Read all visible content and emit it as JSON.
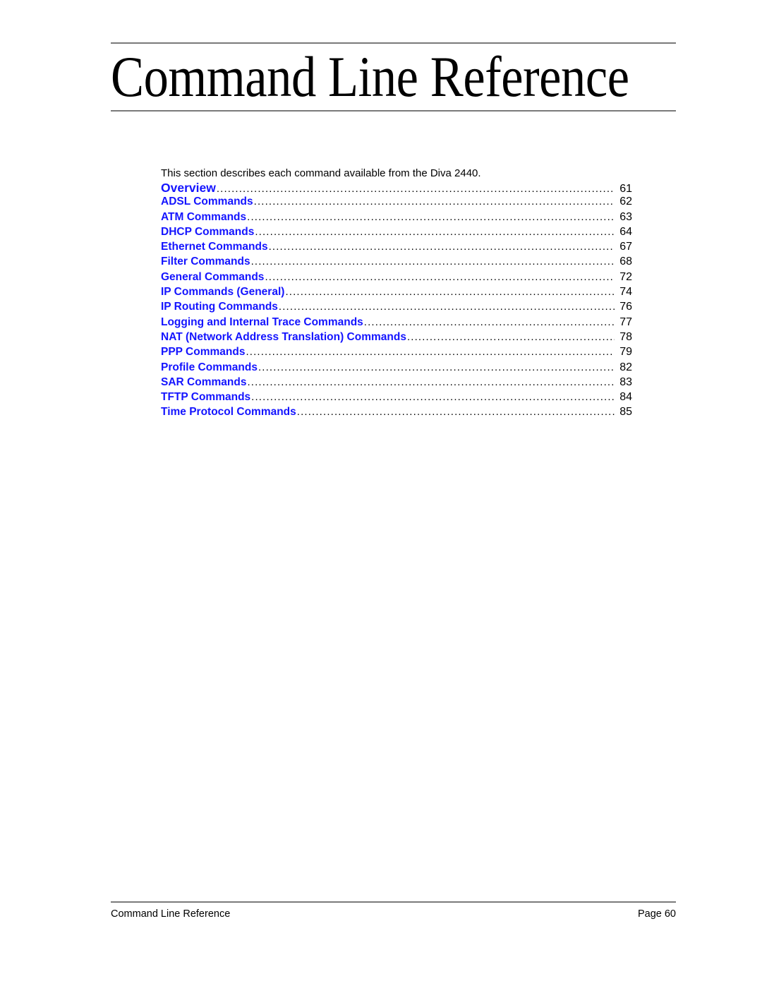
{
  "document": {
    "title": "Command Line Reference",
    "intro": "This section describes each command available from the Diva 2440."
  },
  "toc": {
    "entries": [
      {
        "label": "Overview",
        "page": "61",
        "lead": true
      },
      {
        "label": "ADSL Commands",
        "page": "62",
        "lead": false
      },
      {
        "label": "ATM Commands",
        "page": "63",
        "lead": false
      },
      {
        "label": "DHCP Commands",
        "page": "64",
        "lead": false
      },
      {
        "label": "Ethernet Commands",
        "page": "67",
        "lead": false
      },
      {
        "label": "Filter Commands",
        "page": "68",
        "lead": false
      },
      {
        "label": "General Commands",
        "page": "72",
        "lead": false
      },
      {
        "label": "IP Commands (General)",
        "page": "74",
        "lead": false
      },
      {
        "label": "IP Routing Commands",
        "page": "76",
        "lead": false
      },
      {
        "label": "Logging and Internal Trace Commands",
        "page": "77",
        "lead": false
      },
      {
        "label": "NAT (Network Address Translation) Commands",
        "page": "78",
        "lead": false
      },
      {
        "label": "PPP Commands",
        "page": "79",
        "lead": false
      },
      {
        "label": "Profile Commands",
        "page": "82",
        "lead": false
      },
      {
        "label": "SAR Commands",
        "page": "83",
        "lead": false
      },
      {
        "label": "TFTP Commands",
        "page": "84",
        "lead": false
      },
      {
        "label": "Time Protocol Commands",
        "page": "85",
        "lead": false
      }
    ]
  },
  "footer": {
    "left": "Command Line Reference",
    "right": "Page 60"
  },
  "colors": {
    "toc_link": "#1414ff",
    "rule": "#7a7a7a",
    "text": "#000000",
    "background": "#ffffff"
  }
}
